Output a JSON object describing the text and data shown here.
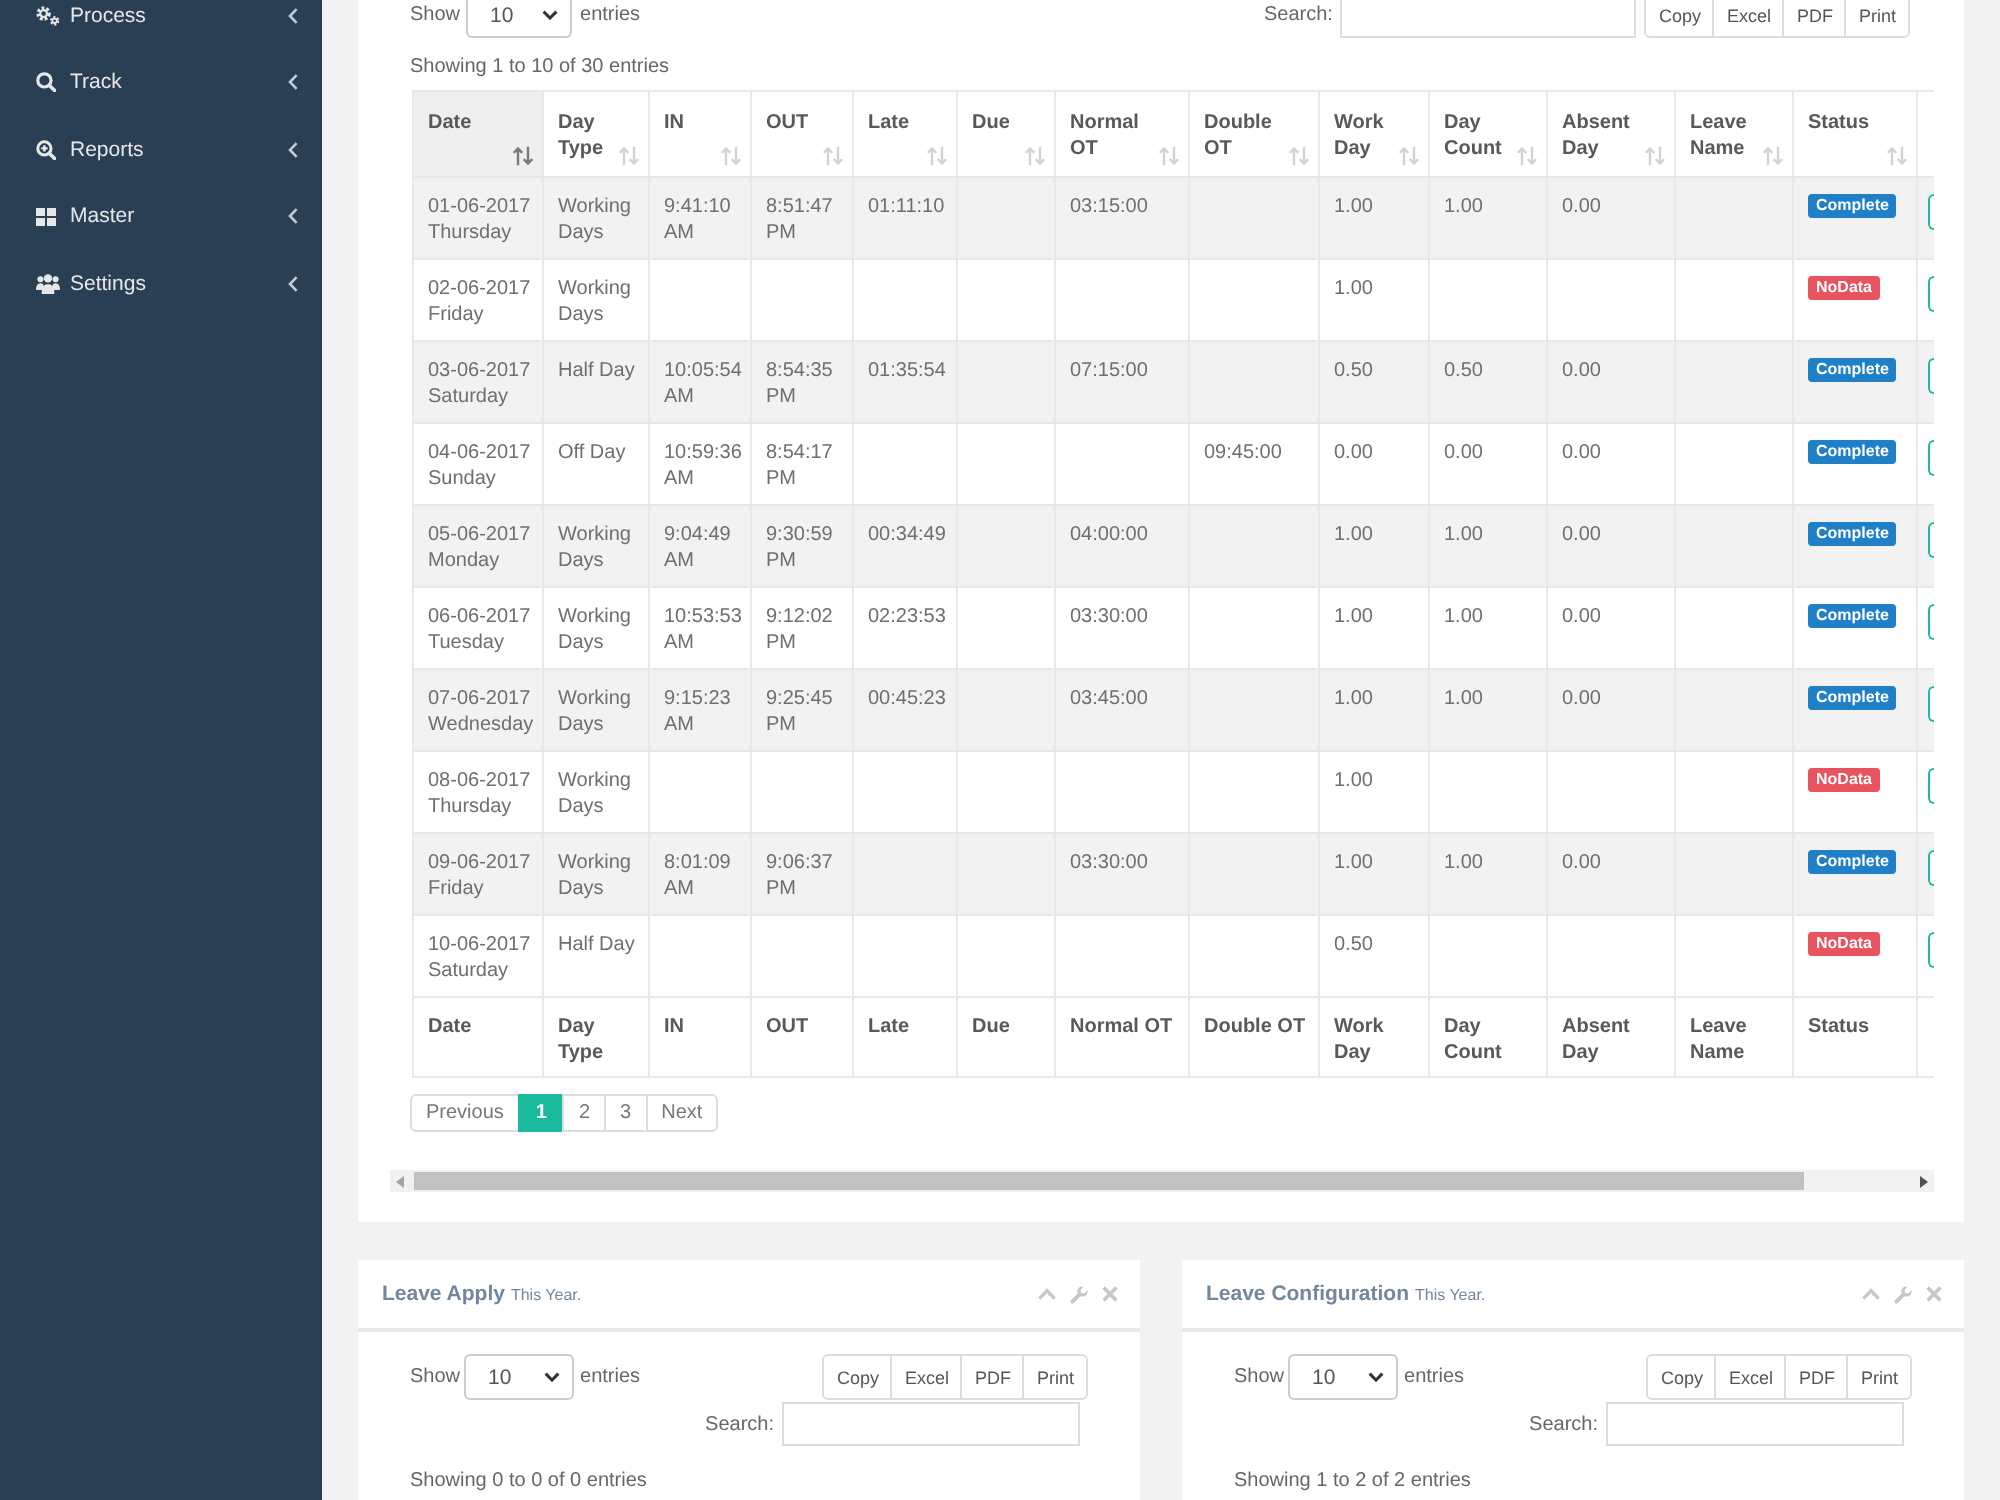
{
  "sidebar": {
    "items": [
      {
        "label": "Process"
      },
      {
        "label": "Track"
      },
      {
        "label": "Reports"
      },
      {
        "label": "Master"
      },
      {
        "label": "Settings"
      }
    ]
  },
  "attendance_panel": {
    "show_label": "Show",
    "page_length": "10",
    "entries_label": "entries",
    "search_label": "Search:",
    "buttons": [
      "Copy",
      "Excel",
      "PDF",
      "Print"
    ],
    "info": "Showing 1 to 10 of 30 entries",
    "table": {
      "columns": [
        {
          "label": "Date",
          "sorted": true
        },
        {
          "label": "Day Type",
          "sorted": false
        },
        {
          "label": "IN",
          "sorted": false
        },
        {
          "label": "OUT",
          "sorted": false
        },
        {
          "label": "Late",
          "sorted": false
        },
        {
          "label": "Due",
          "sorted": false
        },
        {
          "label": "Normal OT",
          "sorted": false
        },
        {
          "label": "Double OT",
          "sorted": false
        },
        {
          "label": "Work Day",
          "sorted": false
        },
        {
          "label": "Day Count",
          "sorted": false
        },
        {
          "label": "Absent Day",
          "sorted": false
        },
        {
          "label": "Leave Name",
          "sorted": false
        },
        {
          "label": "Status",
          "sorted": false
        }
      ],
      "rows": [
        {
          "date": "01-06-2017 Thursday",
          "day_type": "Working Days",
          "in": "9:41:10 AM",
          "out": "8:51:47 PM",
          "late": "01:11:10",
          "normal_ot": "03:15:00",
          "work_day": "1.00",
          "day_count": "1.00",
          "absent_day": "0.00",
          "status": {
            "label": "Complete",
            "color": "#1f7fc7"
          }
        },
        {
          "date": "02-06-2017 Friday",
          "day_type": "Working Days",
          "work_day": "1.00",
          "status": {
            "label": "NoData",
            "color": "#e8535f"
          }
        },
        {
          "date": "03-06-2017 Saturday",
          "day_type": "Half Day",
          "in": "10:05:54 AM",
          "out": "8:54:35 PM",
          "late": "01:35:54",
          "normal_ot": "07:15:00",
          "work_day": "0.50",
          "day_count": "0.50",
          "absent_day": "0.00",
          "status": {
            "label": "Complete",
            "color": "#1f7fc7"
          }
        },
        {
          "date": "04-06-2017 Sunday",
          "day_type": "Off Day",
          "in": "10:59:36 AM",
          "out": "8:54:17 PM",
          "double_ot": "09:45:00",
          "work_day": "0.00",
          "day_count": "0.00",
          "absent_day": "0.00",
          "status": {
            "label": "Complete",
            "color": "#1f7fc7"
          }
        },
        {
          "date": "05-06-2017 Monday",
          "day_type": "Working Days",
          "in": "9:04:49 AM",
          "out": "9:30:59 PM",
          "late": "00:34:49",
          "normal_ot": "04:00:00",
          "work_day": "1.00",
          "day_count": "1.00",
          "absent_day": "0.00",
          "status": {
            "label": "Complete",
            "color": "#1f7fc7"
          }
        },
        {
          "date": "06-06-2017 Tuesday",
          "day_type": "Working Days",
          "in": "10:53:53 AM",
          "out": "9:12:02 PM",
          "late": "02:23:53",
          "normal_ot": "03:30:00",
          "work_day": "1.00",
          "day_count": "1.00",
          "absent_day": "0.00",
          "status": {
            "label": "Complete",
            "color": "#1f7fc7"
          }
        },
        {
          "date": "07-06-2017 Wednesday",
          "day_type": "Working Days",
          "in": "9:15:23 AM",
          "out": "9:25:45 PM",
          "late": "00:45:23",
          "normal_ot": "03:45:00",
          "work_day": "1.00",
          "day_count": "1.00",
          "absent_day": "0.00",
          "status": {
            "label": "Complete",
            "color": "#1f7fc7"
          }
        },
        {
          "date": "08-06-2017 Thursday",
          "day_type": "Working Days",
          "work_day": "1.00",
          "status": {
            "label": "NoData",
            "color": "#e8535f"
          }
        },
        {
          "date": "09-06-2017 Friday",
          "day_type": "Working Days",
          "in": "8:01:09 AM",
          "out": "9:06:37 PM",
          "normal_ot": "03:30:00",
          "work_day": "1.00",
          "day_count": "1.00",
          "absent_day": "0.00",
          "status": {
            "label": "Complete",
            "color": "#1f7fc7"
          }
        },
        {
          "date": "10-06-2017 Saturday",
          "day_type": "Half Day",
          "work_day": "0.50",
          "status": {
            "label": "NoData",
            "color": "#e8535f"
          }
        }
      ],
      "footer": [
        "Date",
        "Day Type",
        "IN",
        "OUT",
        "Late",
        "Due",
        "Normal OT",
        "Double OT",
        "Work Day",
        "Day Count",
        "Absent Day",
        "Leave Name",
        "Status"
      ]
    },
    "pagination": {
      "previous": "Previous",
      "pages": [
        {
          "label": "1",
          "selected": true
        },
        {
          "label": "2",
          "selected": false
        },
        {
          "label": "3",
          "selected": false
        }
      ],
      "next": "Next"
    }
  },
  "leave_panels": [
    {
      "title": "Leave Apply",
      "subtitle": "This Year.",
      "show_label": "Show",
      "page_length": "10",
      "entries_label": "entries",
      "buttons": [
        "Copy",
        "Excel",
        "PDF",
        "Print"
      ],
      "search_label": "Search:",
      "info": "Showing 0 to 0 of 0 entries"
    },
    {
      "title": "Leave Configuration",
      "subtitle": "This Year.",
      "show_label": "Show",
      "page_length": "10",
      "entries_label": "entries",
      "buttons": [
        "Copy",
        "Excel",
        "PDF",
        "Print"
      ],
      "search_label": "Search:",
      "info": "Showing 1 to 2 of 2 entries"
    }
  ]
}
